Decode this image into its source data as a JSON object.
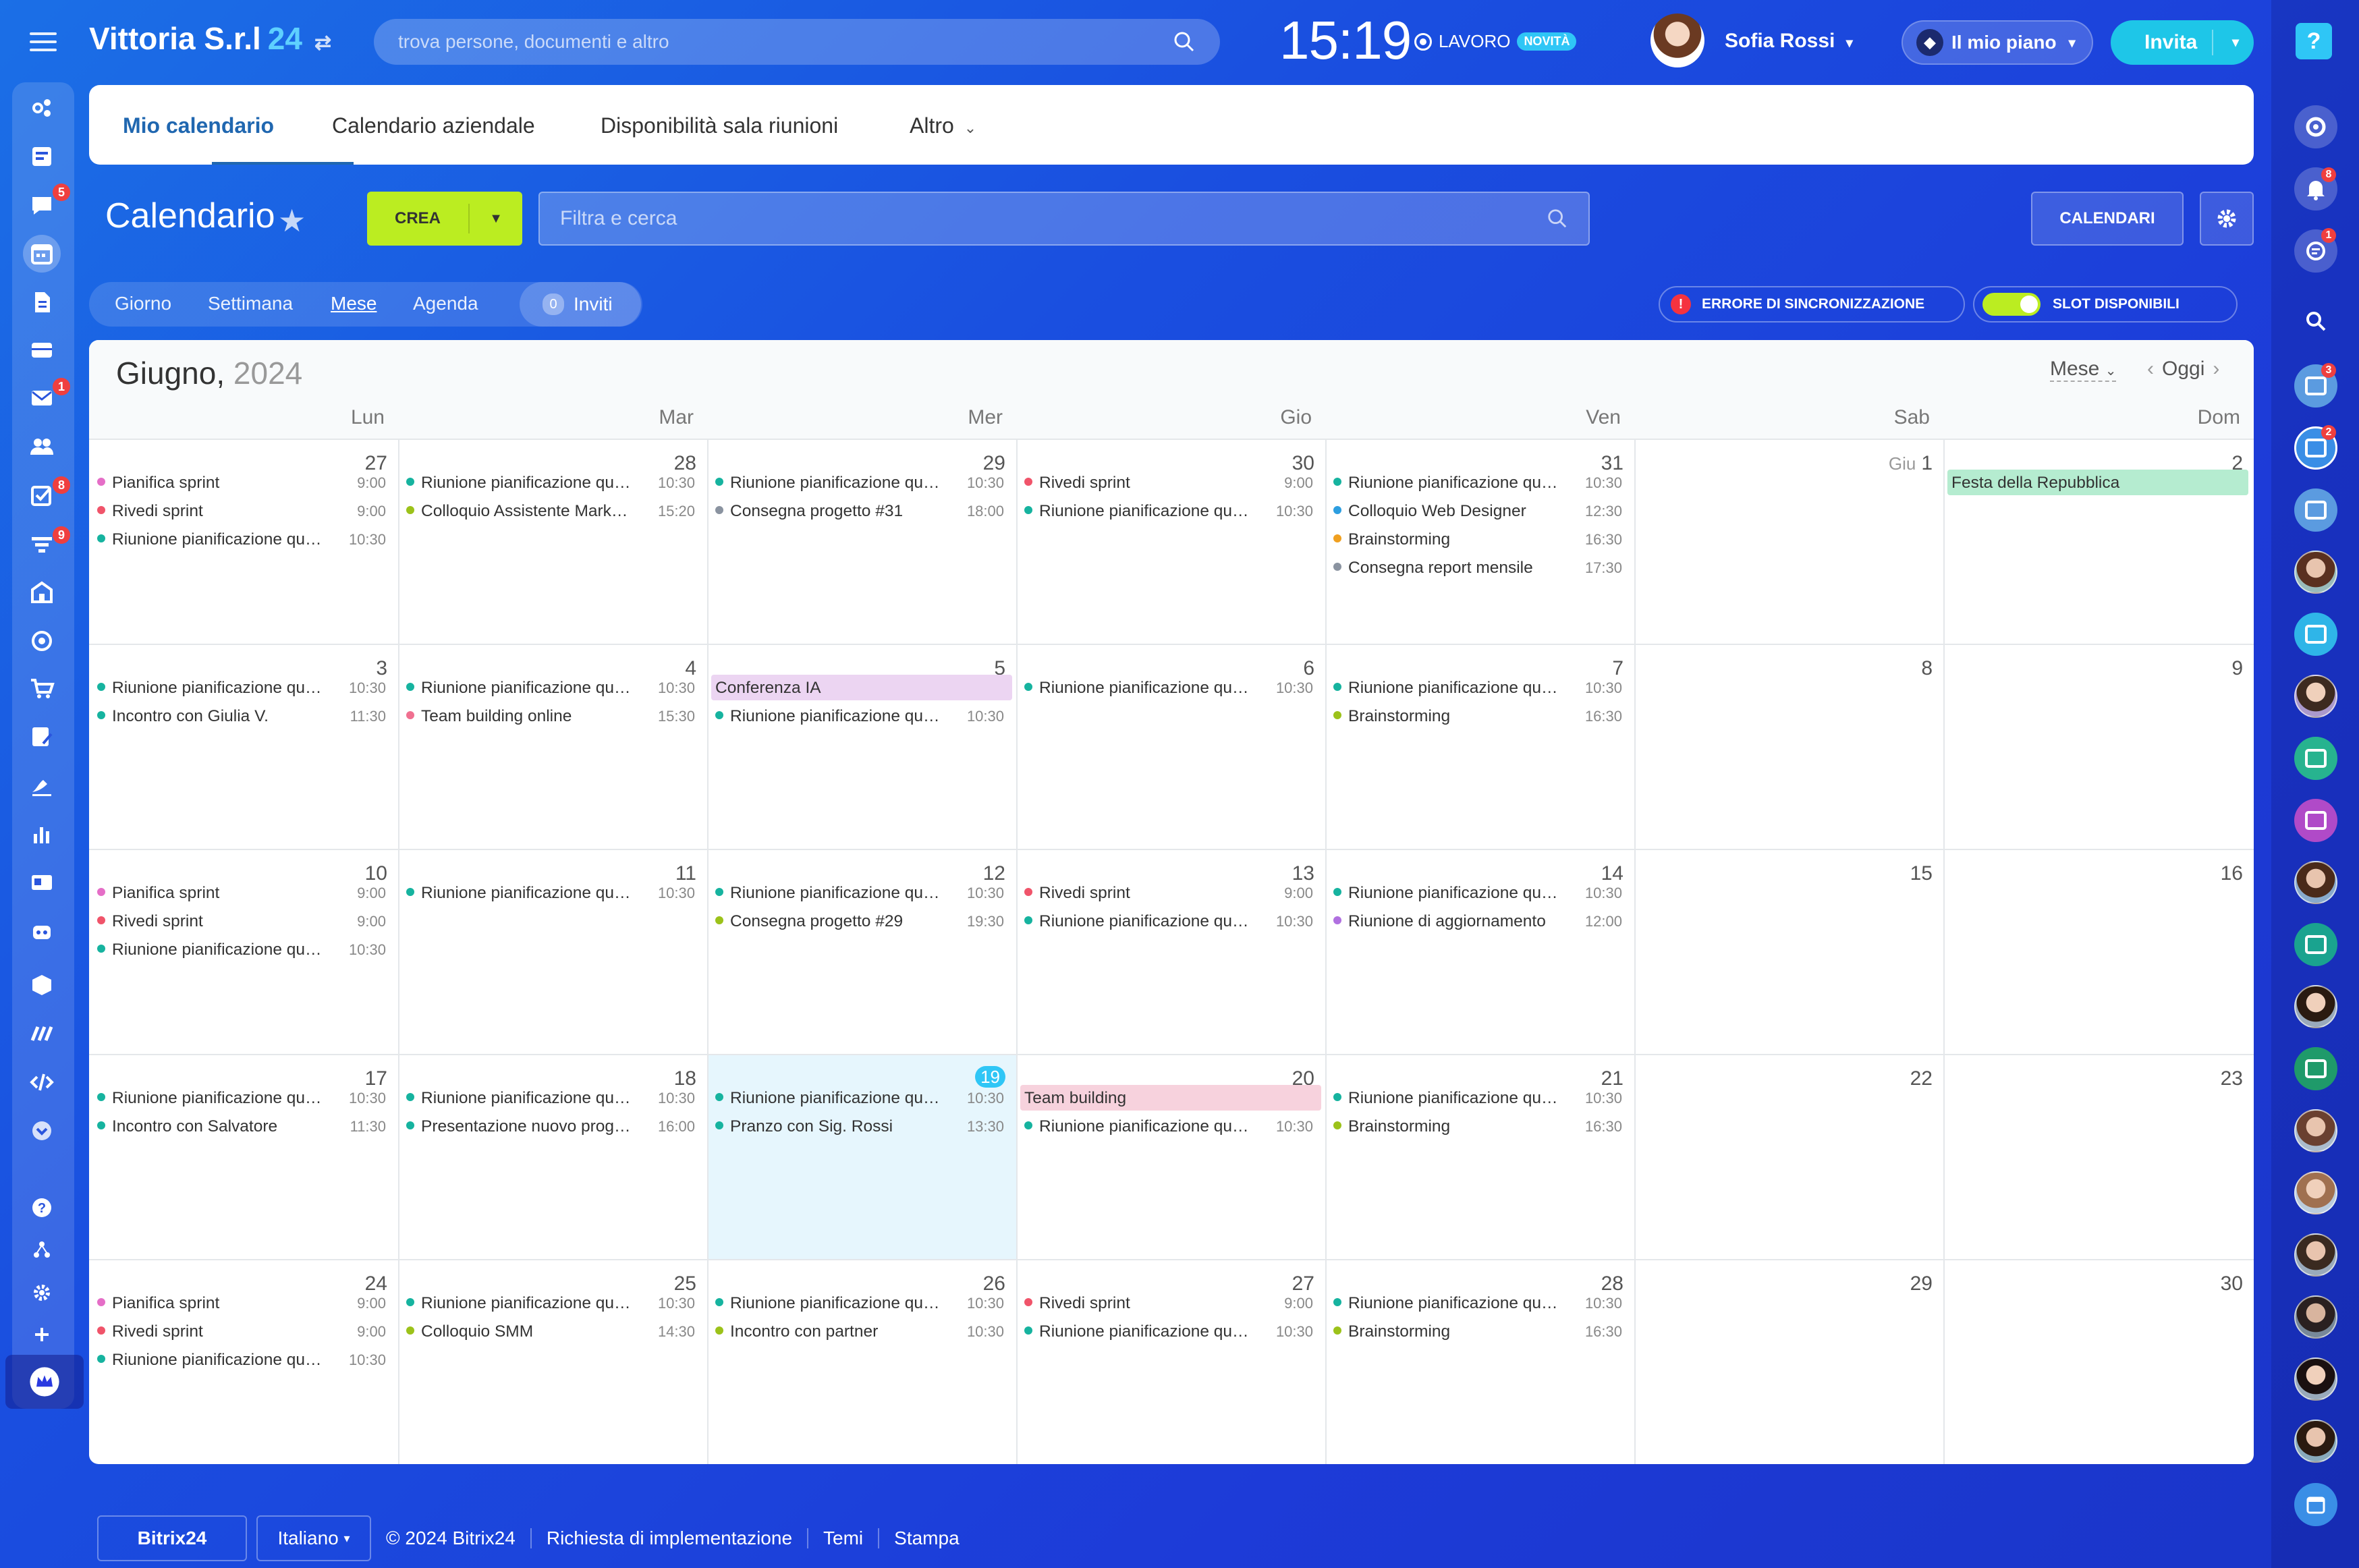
{
  "header": {
    "company": "Vittoria S.r.l",
    "company_suffix": "24",
    "search_placeholder": "trova persone, documenti e altro",
    "clock": "15:19",
    "work_status": "LAVORO",
    "work_badge": "NOVITÀ",
    "user_name": "Sofia Rossi",
    "plan_label": "Il mio piano",
    "invite_label": "Invita"
  },
  "left_rail_badges": {
    "chat": "5",
    "mail": "1",
    "tasks": "8",
    "crm": "9"
  },
  "right_rail_badges": {
    "notifications": "8",
    "messages": "1",
    "app1": "3",
    "app2": "2"
  },
  "tabs": [
    "Mio calendario",
    "Calendario aziendale",
    "Disponibilità sala riunioni",
    "Altro"
  ],
  "toolbar": {
    "title": "Calendario",
    "create_label": "CREA",
    "filter_placeholder": "Filtra e cerca",
    "calendars_label": "CALENDARI"
  },
  "views": {
    "day": "Giorno",
    "week": "Settimana",
    "month": "Mese",
    "agenda": "Agenda",
    "invites": "Inviti",
    "invites_count": "0"
  },
  "sync_error": "ERRORE DI SINCRONIZZAZIONE",
  "slots_label": "SLOT DISPONIBILI",
  "calendar": {
    "month": "Giugno,",
    "year": "2024",
    "view_select": "Mese",
    "today_label": "Oggi",
    "day_names": [
      "Lun",
      "Mar",
      "Mer",
      "Gio",
      "Ven",
      "Sab",
      "Dom"
    ],
    "colors": {
      "pink": "#e56ec7",
      "red": "#f0546a",
      "teal": "#16b39f",
      "green": "#9cc21a",
      "gray": "#8a93a0",
      "orange": "#f0a020",
      "blue": "#2d9ee0",
      "purple": "#b070e0",
      "rose": "#f07090"
    },
    "weeks": [
      [
        {
          "n": "27",
          "events": [
            {
              "t": "Pianifica sprint",
              "h": "9:00",
              "c": "pink"
            },
            {
              "t": "Rivedi sprint",
              "h": "9:00",
              "c": "red"
            },
            {
              "t": "Riunione pianificazione quot…",
              "h": "10:30",
              "c": "teal"
            }
          ]
        },
        {
          "n": "28",
          "events": [
            {
              "t": "Riunione pianificazione quot…",
              "h": "10:30",
              "c": "teal"
            },
            {
              "t": "Colloquio Assistente Market…",
              "h": "15:20",
              "c": "green"
            }
          ]
        },
        {
          "n": "29",
          "events": [
            {
              "t": "Riunione pianificazione quot…",
              "h": "10:30",
              "c": "teal"
            },
            {
              "t": "Consegna progetto #31",
              "h": "18:00",
              "c": "gray"
            }
          ]
        },
        {
          "n": "30",
          "events": [
            {
              "t": "Rivedi sprint",
              "h": "9:00",
              "c": "red"
            },
            {
              "t": "Riunione pianificazione quot…",
              "h": "10:30",
              "c": "teal"
            }
          ]
        },
        {
          "n": "31",
          "events": [
            {
              "t": "Riunione pianificazione quot…",
              "h": "10:30",
              "c": "teal"
            },
            {
              "t": "Colloquio Web Designer",
              "h": "12:30",
              "c": "blue"
            },
            {
              "t": "Brainstorming",
              "h": "16:30",
              "c": "orange"
            },
            {
              "t": "Consegna report mensile",
              "h": "17:30",
              "c": "gray"
            }
          ]
        },
        {
          "n": "1",
          "mon": "Giu",
          "events": []
        },
        {
          "n": "2",
          "bar": {
            "t": "Festa della Repubblica",
            "bg": "#b5ecd0"
          },
          "events": []
        }
      ],
      [
        {
          "n": "3",
          "events": [
            {
              "t": "Riunione pianificazione quot…",
              "h": "10:30",
              "c": "teal"
            },
            {
              "t": "Incontro con Giulia V.",
              "h": "11:30",
              "c": "teal"
            }
          ]
        },
        {
          "n": "4",
          "events": [
            {
              "t": "Riunione pianificazione quot…",
              "h": "10:30",
              "c": "teal"
            },
            {
              "t": "Team building online",
              "h": "15:30",
              "c": "rose"
            }
          ]
        },
        {
          "n": "5",
          "bar": {
            "t": "Conferenza IA",
            "bg": "#ecd5f2"
          },
          "events": [
            {
              "t": "Riunione pianificazione quot…",
              "h": "10:30",
              "c": "teal"
            }
          ]
        },
        {
          "n": "6",
          "events": [
            {
              "t": "Riunione pianificazione quot…",
              "h": "10:30",
              "c": "teal"
            }
          ]
        },
        {
          "n": "7",
          "events": [
            {
              "t": "Riunione pianificazione quot…",
              "h": "10:30",
              "c": "teal"
            },
            {
              "t": "Brainstorming",
              "h": "16:30",
              "c": "green"
            }
          ]
        },
        {
          "n": "8",
          "events": []
        },
        {
          "n": "9",
          "events": []
        }
      ],
      [
        {
          "n": "10",
          "events": [
            {
              "t": "Pianifica sprint",
              "h": "9:00",
              "c": "pink"
            },
            {
              "t": "Rivedi sprint",
              "h": "9:00",
              "c": "red"
            },
            {
              "t": "Riunione pianificazione quot…",
              "h": "10:30",
              "c": "teal"
            }
          ]
        },
        {
          "n": "11",
          "events": [
            {
              "t": "Riunione pianificazione quot…",
              "h": "10:30",
              "c": "teal"
            }
          ]
        },
        {
          "n": "12",
          "events": [
            {
              "t": "Riunione pianificazione quot…",
              "h": "10:30",
              "c": "teal"
            },
            {
              "t": "Consegna progetto #29",
              "h": "19:30",
              "c": "green"
            }
          ]
        },
        {
          "n": "13",
          "events": [
            {
              "t": "Rivedi sprint",
              "h": "9:00",
              "c": "red"
            },
            {
              "t": "Riunione pianificazione quot…",
              "h": "10:30",
              "c": "teal"
            }
          ]
        },
        {
          "n": "14",
          "events": [
            {
              "t": "Riunione pianificazione quot…",
              "h": "10:30",
              "c": "teal"
            },
            {
              "t": "Riunione di aggiornamento",
              "h": "12:00",
              "c": "purple"
            }
          ]
        },
        {
          "n": "15",
          "events": []
        },
        {
          "n": "16",
          "events": []
        }
      ],
      [
        {
          "n": "17",
          "events": [
            {
              "t": "Riunione pianificazione quot…",
              "h": "10:30",
              "c": "teal"
            },
            {
              "t": "Incontro con Salvatore",
              "h": "11:30",
              "c": "teal"
            }
          ]
        },
        {
          "n": "18",
          "events": [
            {
              "t": "Riunione pianificazione quot…",
              "h": "10:30",
              "c": "teal"
            },
            {
              "t": "Presentazione nuovo proget…",
              "h": "16:00",
              "c": "teal"
            }
          ]
        },
        {
          "n": "19",
          "today": true,
          "events": [
            {
              "t": "Riunione pianificazione quot…",
              "h": "10:30",
              "c": "teal"
            },
            {
              "t": "Pranzo con Sig. Rossi",
              "h": "13:30",
              "c": "teal"
            }
          ]
        },
        {
          "n": "20",
          "bar": {
            "t": "Team building",
            "bg": "#f7d2dd"
          },
          "events": [
            {
              "t": "Riunione pianificazione quot…",
              "h": "10:30",
              "c": "teal"
            }
          ]
        },
        {
          "n": "21",
          "events": [
            {
              "t": "Riunione pianificazione quot…",
              "h": "10:30",
              "c": "teal"
            },
            {
              "t": "Brainstorming",
              "h": "16:30",
              "c": "green"
            }
          ]
        },
        {
          "n": "22",
          "events": []
        },
        {
          "n": "23",
          "events": []
        }
      ],
      [
        {
          "n": "24",
          "events": [
            {
              "t": "Pianifica sprint",
              "h": "9:00",
              "c": "pink"
            },
            {
              "t": "Rivedi sprint",
              "h": "9:00",
              "c": "red"
            },
            {
              "t": "Riunione pianificazione quot…",
              "h": "10:30",
              "c": "teal"
            }
          ]
        },
        {
          "n": "25",
          "events": [
            {
              "t": "Riunione pianificazione quot…",
              "h": "10:30",
              "c": "teal"
            },
            {
              "t": "Colloquio SMM",
              "h": "14:30",
              "c": "green"
            }
          ]
        },
        {
          "n": "26",
          "events": [
            {
              "t": "Riunione pianificazione quot…",
              "h": "10:30",
              "c": "teal"
            },
            {
              "t": "Incontro con partner",
              "h": "10:30",
              "c": "green"
            }
          ]
        },
        {
          "n": "27",
          "events": [
            {
              "t": "Rivedi sprint",
              "h": "9:00",
              "c": "red"
            },
            {
              "t": "Riunione pianificazione quot…",
              "h": "10:30",
              "c": "teal"
            }
          ]
        },
        {
          "n": "28",
          "events": [
            {
              "t": "Riunione pianificazione quot…",
              "h": "10:30",
              "c": "teal"
            },
            {
              "t": "Brainstorming",
              "h": "16:30",
              "c": "green"
            }
          ]
        },
        {
          "n": "29",
          "events": []
        },
        {
          "n": "30",
          "events": []
        }
      ]
    ]
  },
  "footer": {
    "brand": "Bitrix24",
    "language": "Italiano",
    "copyright": "© 2024 Bitrix24",
    "links": [
      "Richiesta di implementazione",
      "Temi",
      "Stampa"
    ]
  }
}
